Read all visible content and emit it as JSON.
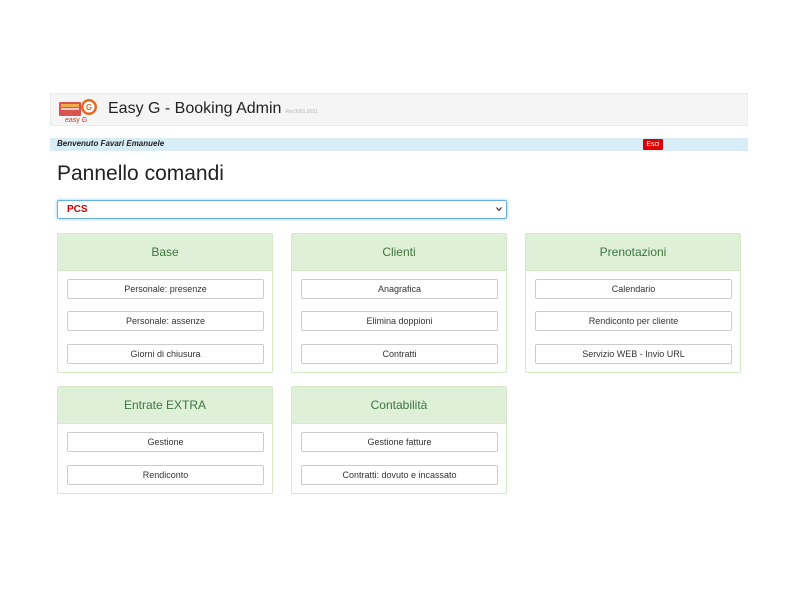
{
  "header": {
    "logo_text": "easy G",
    "title": "Easy G - Booking Admin",
    "version": "Rel 0001.0021"
  },
  "welcome_bar": {
    "text": "Benvenuto Favari Emanuele",
    "logout_label": "Esci"
  },
  "page_title": "Pannello comandi",
  "site_select": {
    "selected": "PCS"
  },
  "panels": [
    {
      "title": "Base",
      "buttons": [
        "Personale: presenze",
        "Personale: assenze",
        "Giorni di chiusura"
      ]
    },
    {
      "title": "Clienti",
      "buttons": [
        "Anagrafica",
        "Elimina doppioni",
        "Contratti"
      ]
    },
    {
      "title": "Prenotazioni",
      "buttons": [
        "Calendario",
        "Rendiconto per cliente",
        "Servizio WEB - Invio URL"
      ]
    },
    {
      "title": "Entrate EXTRA",
      "buttons": [
        "Gestione",
        "Rendiconto"
      ]
    },
    {
      "title": "Contabilità",
      "buttons": [
        "Gestione fatture",
        "Contratti: dovuto e incassato"
      ]
    }
  ],
  "colors": {
    "panel_heading_bg": "#dff0d8",
    "panel_heading_text": "#3c763d",
    "welcome_bar_bg": "#d9edf7",
    "logout_bg": "#e00000",
    "select_value": "#d00000"
  }
}
